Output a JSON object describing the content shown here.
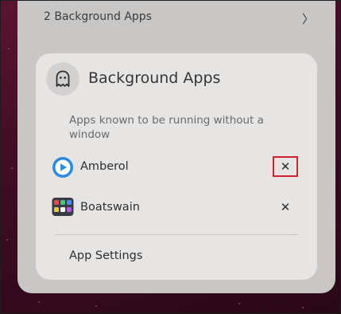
{
  "quick_settings": {
    "background_apps_summary": "2 Background Apps",
    "chevron": "〉"
  },
  "popover": {
    "title": "Background Apps",
    "description": "Apps known to be running without a window",
    "apps": [
      {
        "name": "Amberol",
        "icon": "amberol-icon",
        "close": "✕"
      },
      {
        "name": "Boatswain",
        "icon": "boatswain-icon",
        "close": "✕"
      }
    ],
    "settings_label": "App Settings"
  },
  "colors": {
    "accent_focus": "#d11f2f",
    "amberol_blue": "#2a8ae0",
    "card_bg": "#e6e5e4"
  }
}
